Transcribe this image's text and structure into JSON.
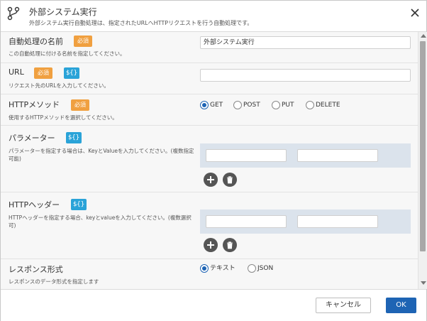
{
  "header": {
    "title": "外部システム実行",
    "subtitle": "外部システム実行自動処理は、指定されたURLへHTTPリクエストを行う自動処理です。",
    "icon": "flow-icon",
    "close_icon": "close-icon"
  },
  "badges": {
    "required": "必須",
    "variable": "${}"
  },
  "fields": {
    "name": {
      "label": "自動処理の名前",
      "desc": "この自動処理に付ける名前を指定してください。",
      "value": "外部システム実行"
    },
    "url": {
      "label": "URL",
      "desc": "リクエスト先のURLを入力してください。",
      "value": ""
    },
    "method": {
      "label": "HTTPメソッド",
      "desc": "使用するHTTPメソッドを選択してください。",
      "options": [
        "GET",
        "POST",
        "PUT",
        "DELETE"
      ],
      "selected": "GET"
    },
    "params": {
      "label": "パラメーター",
      "desc": "パラメーターを指定する場合は、KeyとValueを入力してください。(複数指定可能)",
      "key": "",
      "value": ""
    },
    "headers": {
      "label": "HTTPヘッダー",
      "desc": "HTTPヘッダーを指定する場合、keyとvalueを入力してください。(複数選択可)",
      "key": "",
      "value": ""
    },
    "response": {
      "label": "レスポンス形式",
      "desc": "レスポンスのデータ形式を指定します",
      "options": [
        "テキスト",
        "JSON"
      ],
      "selected": "テキスト"
    }
  },
  "footer": {
    "cancel": "キャンセル",
    "ok": "OK"
  },
  "colors": {
    "required_badge": "#f0a040",
    "variable_badge": "#2aa3d8",
    "primary": "#1e64b4",
    "kv_panel": "#dbe3ec"
  }
}
